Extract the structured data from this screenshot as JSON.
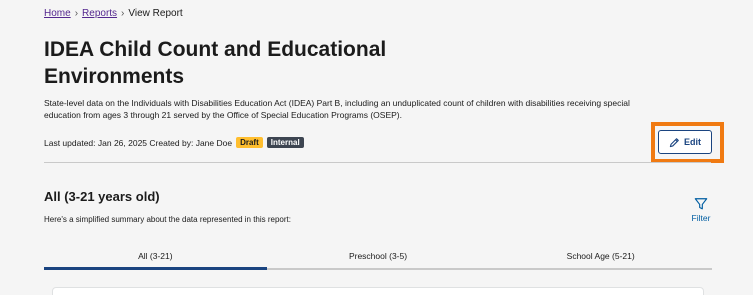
{
  "breadcrumb": {
    "home": "Home",
    "reports": "Reports",
    "current": "View Report",
    "separator": "›"
  },
  "report": {
    "title": "IDEA Child Count and Educational Environments",
    "description": "State-level data on the Individuals with Disabilities Education Act (IDEA) Part B, including an unduplicated count of children with disabilities receiving special education from ages 3 through 21 served by the Office of Special Education Programs (OSEP).",
    "meta": "Last updated: Jan 26, 2025 Created by: Jane Doe",
    "badge_draft": "Draft",
    "badge_internal": "Internal"
  },
  "actions": {
    "edit_label": "Edit",
    "edit_icon": "pencil-icon",
    "highlight_color": "#f07a12"
  },
  "section": {
    "title": "All (3-21 years old)",
    "subtitle": "Here's a simplified summary about the data represented in this report:",
    "filter_label": "Filter",
    "filter_icon": "funnel-icon"
  },
  "tabs": [
    {
      "label": "All (3-21)",
      "active": true
    },
    {
      "label": "Preschool (3-5)",
      "active": false
    },
    {
      "label": "School Age (5-21)",
      "active": false
    }
  ],
  "colors": {
    "primary": "#1a4480",
    "link": "#54278f",
    "draft": "#ffbe2e",
    "internal": "#3d4551"
  }
}
